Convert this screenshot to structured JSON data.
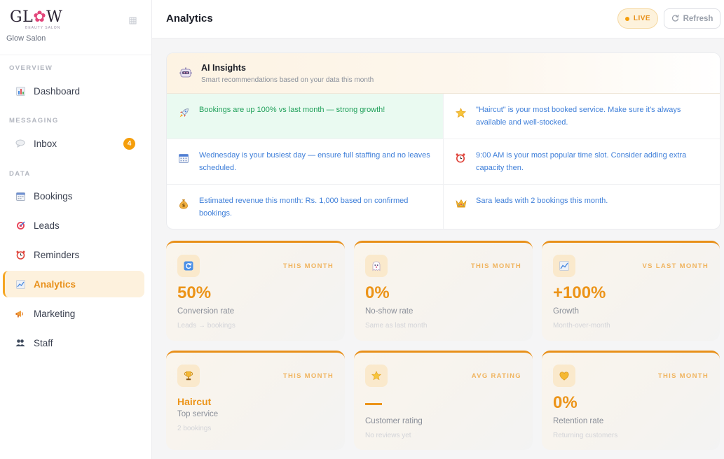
{
  "brand": {
    "logo_text_a": "GL",
    "logo_text_b": "W",
    "logo_sub": "BEAUTY SALON",
    "name": "Glow Salon"
  },
  "sidebar": {
    "sections": [
      "OVERVIEW",
      "MESSAGING",
      "DATA"
    ],
    "items": [
      {
        "label": "Dashboard",
        "icon": "bar-chart-icon"
      },
      {
        "label": "Inbox",
        "icon": "speech-bubble-icon",
        "badge": "4"
      },
      {
        "label": "Bookings",
        "icon": "calendar-icon"
      },
      {
        "label": "Leads",
        "icon": "target-icon"
      },
      {
        "label": "Reminders",
        "icon": "alarm-clock-icon"
      },
      {
        "label": "Analytics",
        "icon": "line-chart-icon",
        "active": true
      },
      {
        "label": "Marketing",
        "icon": "megaphone-icon"
      },
      {
        "label": "Staff",
        "icon": "people-icon"
      }
    ]
  },
  "header": {
    "title": "Analytics",
    "live_label": "LIVE",
    "refresh_label": "Refresh"
  },
  "insights": {
    "title": "AI Insights",
    "subtitle": "Smart recommendations based on your data this month",
    "items": [
      {
        "icon": "rocket-icon",
        "text": "Bookings are up 100% vs last month — strong growth!"
      },
      {
        "icon": "star-icon",
        "text": "\"Haircut\" is your most booked service. Make sure it's always available and well-stocked."
      },
      {
        "icon": "calendar-icon",
        "text": "Wednesday is your busiest day — ensure full staffing and no leaves scheduled."
      },
      {
        "icon": "alarm-clock-icon",
        "text": "9:00 AM is your most popular time slot. Consider adding extra capacity then."
      },
      {
        "icon": "money-bag-icon",
        "text": "Estimated revenue this month: Rs. 1,000 based on confirmed bookings."
      },
      {
        "icon": "crown-icon",
        "text": "Sara leads with 2 bookings this month."
      }
    ]
  },
  "stats": [
    {
      "tag": "THIS MONTH",
      "value": "50%",
      "label": "Conversion rate",
      "note": "Leads → bookings",
      "icon": "refresh-icon"
    },
    {
      "tag": "THIS MONTH",
      "value": "0%",
      "label": "No-show rate",
      "note": "Same as last month",
      "icon": "ghost-icon"
    },
    {
      "tag": "VS LAST MONTH",
      "value": "+100%",
      "label": "Growth",
      "note": "Month-over-month",
      "icon": "line-chart-icon"
    },
    {
      "tag": "THIS MONTH",
      "value": "Haircut",
      "label": "Top service",
      "note": "2 bookings",
      "icon": "trophy-icon"
    },
    {
      "tag": "AVG RATING",
      "value": "",
      "label": "Customer rating",
      "note": "No reviews yet",
      "icon": "star-icon"
    },
    {
      "tag": "THIS MONTH",
      "value": "0%",
      "label": "Retention rate",
      "note": "Returning customers",
      "icon": "heart-icon"
    }
  ],
  "colors": {
    "accent": "#e8901a",
    "link_blue": "#3f7fd9",
    "success_green": "#20a05a"
  }
}
